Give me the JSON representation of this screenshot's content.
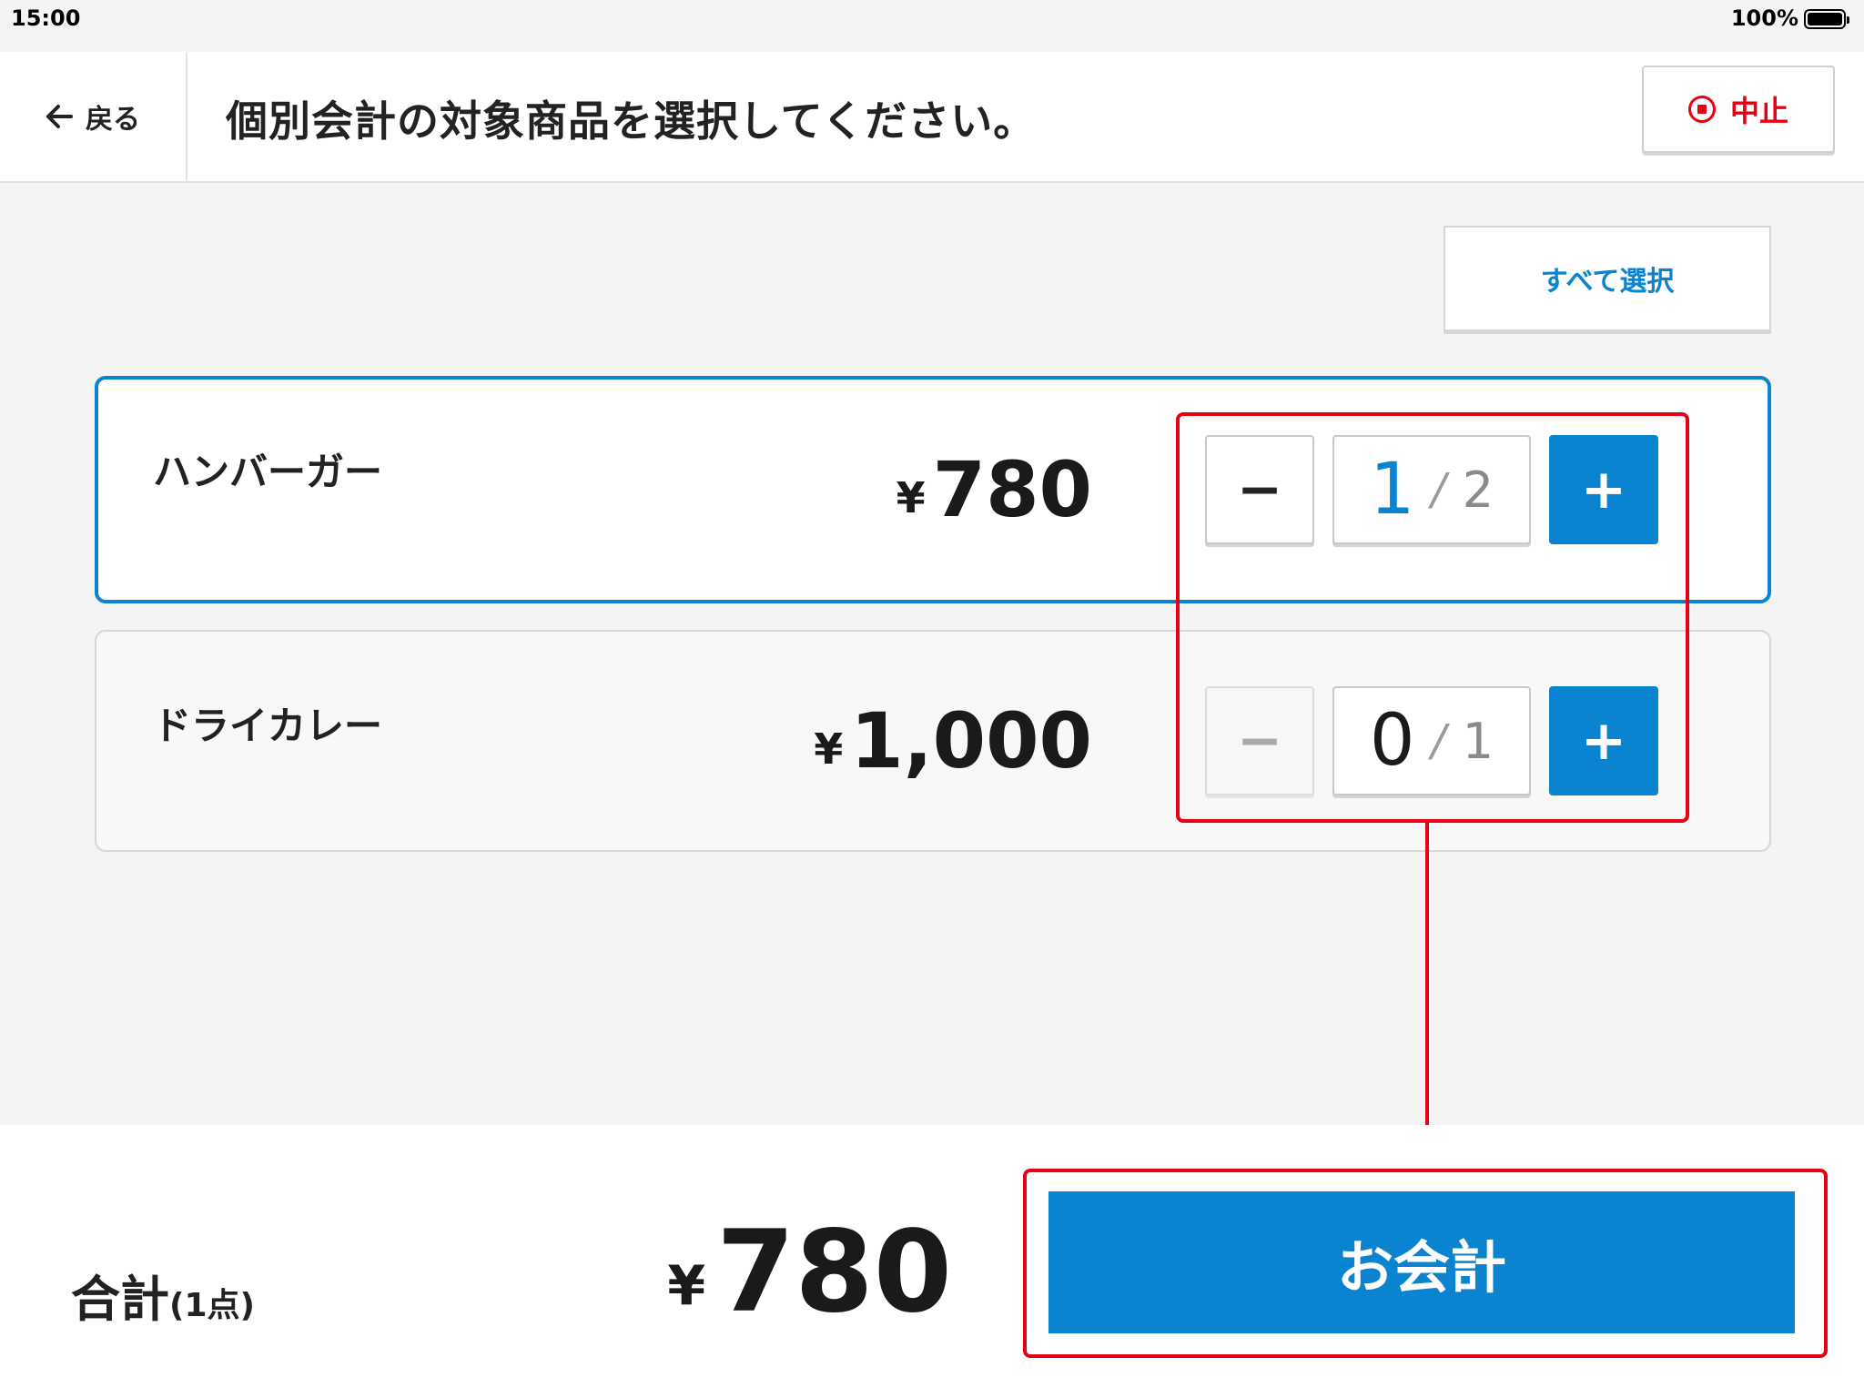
{
  "status_bar": {
    "time": "15:00",
    "battery": "100%"
  },
  "header": {
    "back_label": "戻る",
    "title": "個別会計の対象商品を選択してください。",
    "stop_label": "中止"
  },
  "select_all_label": "すべて選択",
  "items": [
    {
      "name": "ハンバーガー",
      "currency": "¥",
      "price": "780",
      "selected_qty": "1",
      "separator": "/",
      "total_qty": "2",
      "minus": "−",
      "plus": "+"
    },
    {
      "name": "ドライカレー",
      "currency": "¥",
      "price": "1,000",
      "selected_qty": "0",
      "separator": "/",
      "total_qty": "1",
      "minus": "−",
      "plus": "+"
    }
  ],
  "footer": {
    "total_label": "合計",
    "total_count": "(1点)",
    "currency": "¥",
    "total_price": "780",
    "checkout_label": "お会計"
  },
  "colors": {
    "accent": "#0a84d0",
    "danger": "#e60012",
    "background": "#f4f4f4"
  }
}
